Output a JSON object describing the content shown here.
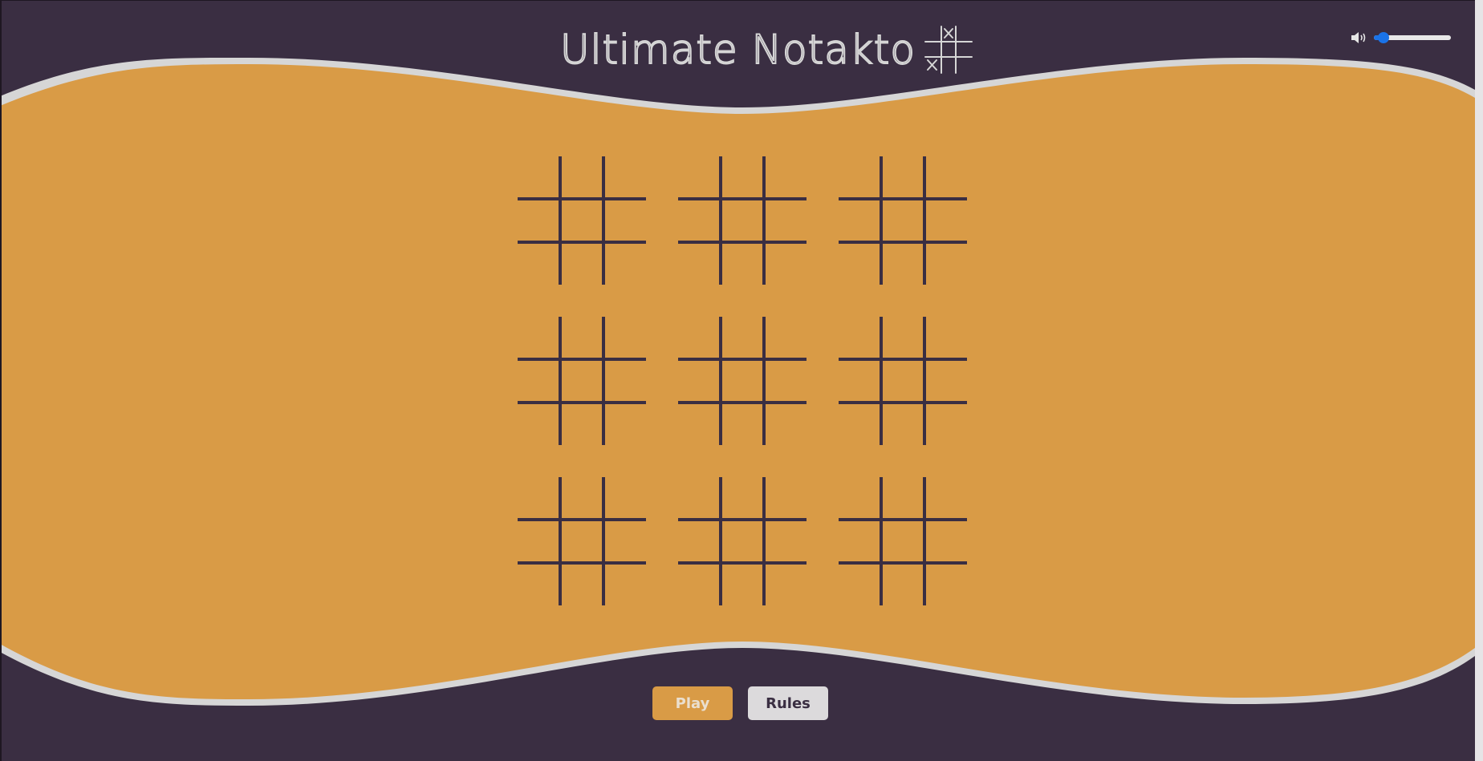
{
  "header": {
    "title": "Ultimate Notakto",
    "logo_icon": "tic-tac-toe-grid-icon",
    "volume": {
      "icon": "speaker-volume-icon",
      "level": 0.12
    }
  },
  "board": {
    "rows": 3,
    "cols": 3,
    "mini_boards": [
      {
        "cells": [
          "",
          "",
          "",
          "",
          "",
          "",
          "",
          "",
          ""
        ]
      },
      {
        "cells": [
          "",
          "",
          "",
          "",
          "",
          "",
          "",
          "",
          ""
        ]
      },
      {
        "cells": [
          "",
          "",
          "",
          "",
          "",
          "",
          "",
          "",
          ""
        ]
      },
      {
        "cells": [
          "",
          "",
          "",
          "",
          "",
          "",
          "",
          "",
          ""
        ]
      },
      {
        "cells": [
          "",
          "",
          "",
          "",
          "",
          "",
          "",
          "",
          ""
        ]
      },
      {
        "cells": [
          "",
          "",
          "",
          "",
          "",
          "",
          "",
          "",
          ""
        ]
      },
      {
        "cells": [
          "",
          "",
          "",
          "",
          "",
          "",
          "",
          "",
          ""
        ]
      },
      {
        "cells": [
          "",
          "",
          "",
          "",
          "",
          "",
          "",
          "",
          ""
        ]
      },
      {
        "cells": [
          "",
          "",
          "",
          "",
          "",
          "",
          "",
          "",
          ""
        ]
      }
    ]
  },
  "actions": {
    "play_label": "Play",
    "rules_label": "Rules"
  },
  "colors": {
    "background": "#3a2e42",
    "play_area": "#d99b46",
    "wave_border": "#d6d6d6",
    "grid_lines": "#3a2e42",
    "slider_accent": "#1a73e8"
  }
}
